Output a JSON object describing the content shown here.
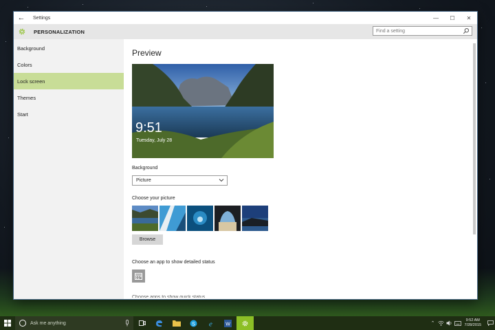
{
  "window": {
    "back_glyph": "←",
    "title": "Settings",
    "controls": {
      "minimize": "—",
      "maximize": "☐",
      "close": "✕"
    }
  },
  "header": {
    "title": "PERSONALIZATION",
    "search_placeholder": "Find a setting",
    "accent": "#8cbf26"
  },
  "sidebar": {
    "items": [
      {
        "label": "Background",
        "active": false
      },
      {
        "label": "Colors",
        "active": false
      },
      {
        "label": "Lock screen",
        "active": true
      },
      {
        "label": "Themes",
        "active": false
      },
      {
        "label": "Start",
        "active": false
      }
    ],
    "active_color": "#c8dd97"
  },
  "main": {
    "preview_heading": "Preview",
    "preview_time": "9:51",
    "preview_date": "Tuesday, July 28",
    "background_label": "Background",
    "background_value": "Picture",
    "choose_picture_label": "Choose your picture",
    "browse_label": "Browse",
    "detailed_status_label": "Choose an app to show detailed status",
    "quick_status_label": "Choose apps to show quick status"
  },
  "taskbar": {
    "search_placeholder": "Ask me anything",
    "tray_time": "9:52 AM",
    "tray_date": "7/28/2015",
    "active_color": "#8cbf26"
  }
}
